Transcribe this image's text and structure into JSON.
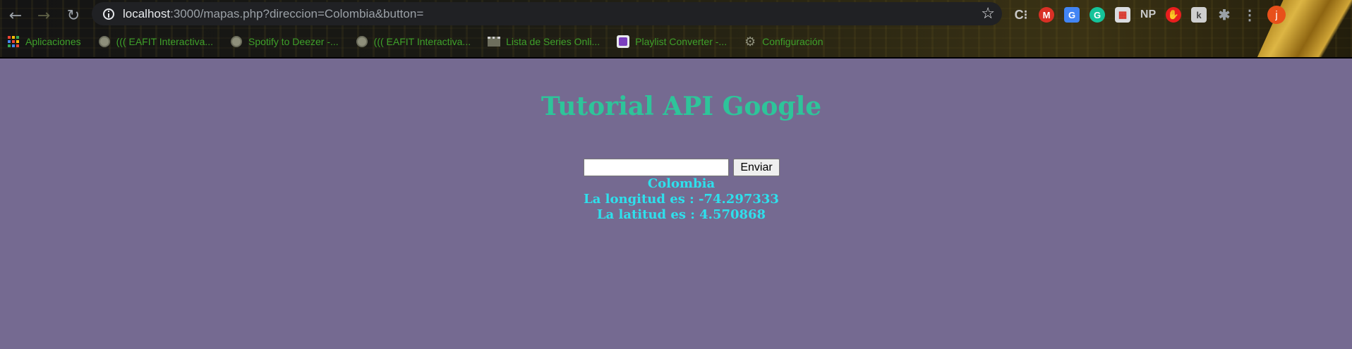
{
  "browser": {
    "url_host": "localhost",
    "url_rest": ":3000/mapas.php?direccion=Colombia&button=",
    "avatar_letter": "j",
    "extensions": [
      "C⁝",
      "M",
      "G",
      "G",
      "▦",
      "NP",
      "✋",
      "k",
      "✱",
      "⋮"
    ]
  },
  "bookmarks": [
    {
      "label": "Aplicaciones",
      "icon": "apps-grid-icon"
    },
    {
      "label": "((( EAFIT Interactiva...",
      "icon": "globe-icon"
    },
    {
      "label": "Spotify to Deezer -...",
      "icon": "globe-icon"
    },
    {
      "label": "((( EAFIT Interactiva...",
      "icon": "globe-icon"
    },
    {
      "label": "Lista de Series Onli...",
      "icon": "film-icon"
    },
    {
      "label": "Playlist Converter -...",
      "icon": "playlist-icon"
    },
    {
      "label": "Configuración",
      "icon": "gear-icon"
    }
  ],
  "page": {
    "title": "Tutorial API Google",
    "search_value": "",
    "button_label": "Enviar",
    "place": "Colombia",
    "longitude_line": "La longitud es : -74.297333",
    "latitude_line": "La latitud es : 4.570868"
  },
  "colors": {
    "background": "#756a91",
    "title": "#2ec49a",
    "results": "#2ee0ec",
    "bookmark_text": "#3fa12a"
  }
}
